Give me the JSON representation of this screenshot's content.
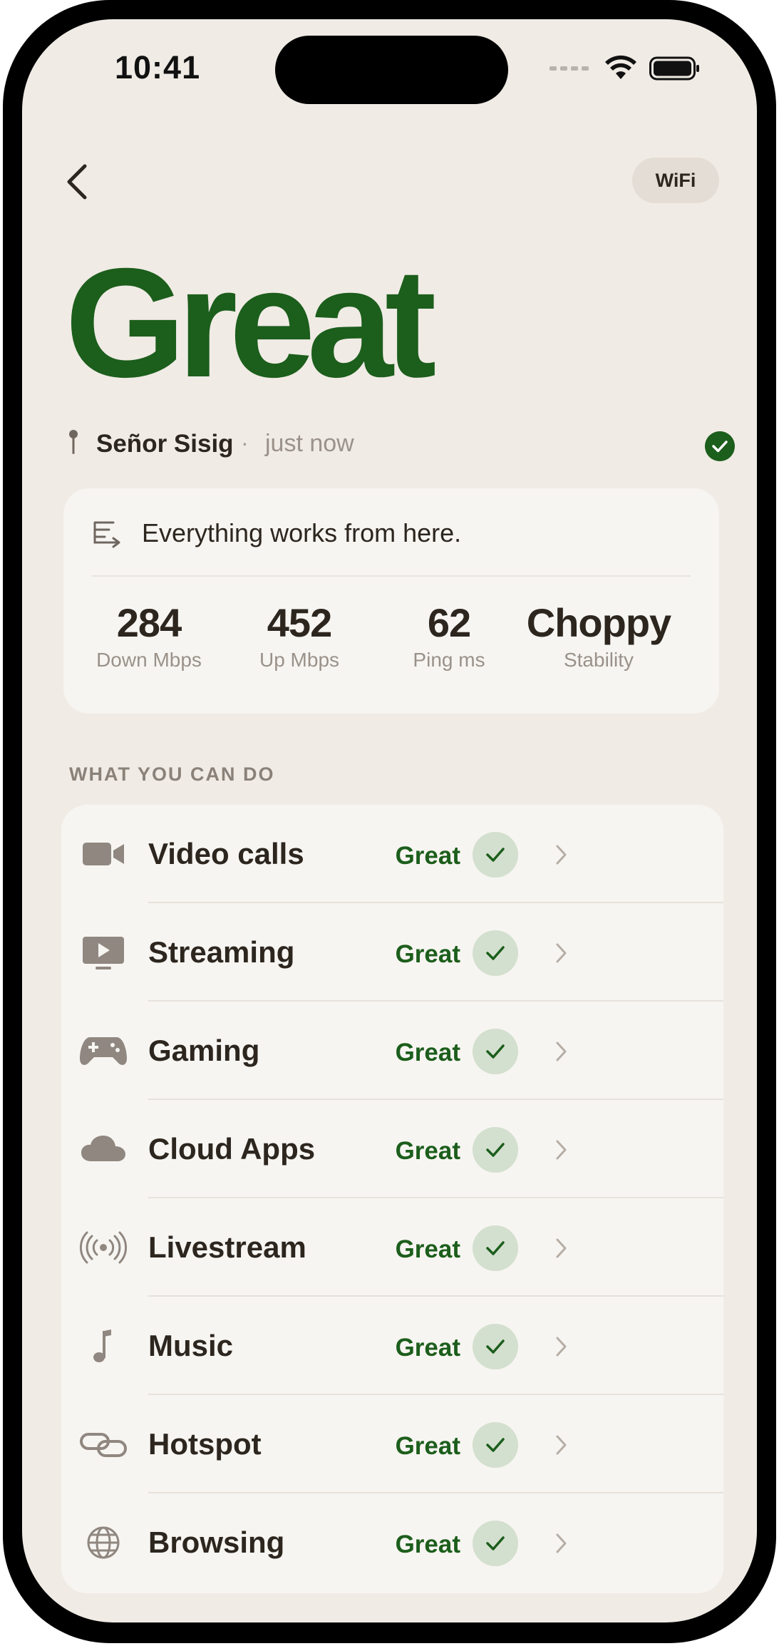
{
  "status_bar": {
    "time": "10:41"
  },
  "header": {
    "back_icon": "chevron-left-icon",
    "network_pill": "WiFi"
  },
  "hero": {
    "rating": "Great"
  },
  "location": {
    "name": "Señor Sisig",
    "separator": "·",
    "updated": "just now",
    "status_icon": "check-circle-icon"
  },
  "summary": {
    "icon": "list-arrow-icon",
    "message": "Everything works from here.",
    "stats": [
      {
        "value": "284",
        "label": "Down Mbps"
      },
      {
        "value": "452",
        "label": "Up Mbps"
      },
      {
        "value": "62",
        "label": "Ping ms"
      },
      {
        "value": "Choppy",
        "label": "Stability"
      }
    ]
  },
  "capabilities": {
    "section_title": "WHAT YOU CAN DO",
    "items": [
      {
        "label": "Video calls",
        "status": "Great",
        "icon": "video-camera-icon"
      },
      {
        "label": "Streaming",
        "status": "Great",
        "icon": "tv-play-icon"
      },
      {
        "label": "Gaming",
        "status": "Great",
        "icon": "gamepad-icon"
      },
      {
        "label": "Cloud Apps",
        "status": "Great",
        "icon": "cloud-icon"
      },
      {
        "label": "Livestream",
        "status": "Great",
        "icon": "broadcast-icon"
      },
      {
        "label": "Music",
        "status": "Great",
        "icon": "music-note-icon"
      },
      {
        "label": "Hotspot",
        "status": "Great",
        "icon": "link-icon"
      },
      {
        "label": "Browsing",
        "status": "Great",
        "icon": "globe-icon"
      }
    ]
  },
  "colors": {
    "accent_green": "#1c5e1c",
    "background": "#f0ebe5",
    "card": "#f7f5f1",
    "check_bg": "#d4e0cf",
    "muted": "#9a928a"
  }
}
